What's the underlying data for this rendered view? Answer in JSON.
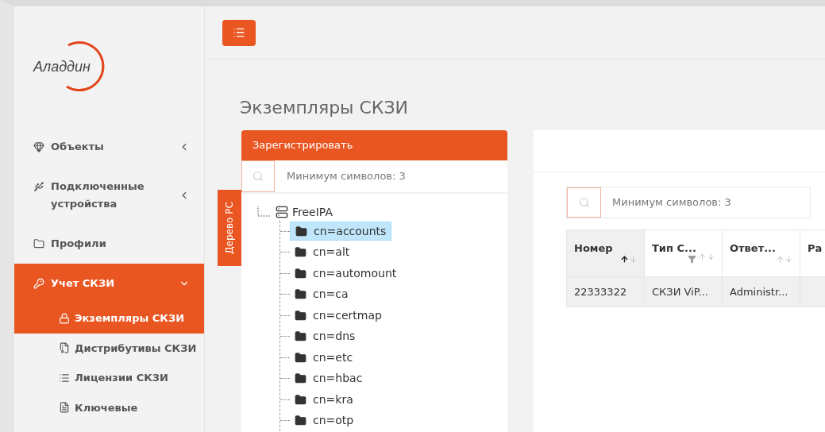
{
  "logo": {
    "text": "Аладдин"
  },
  "sidebar": {
    "items": [
      {
        "label": "Объекты",
        "kind": "group",
        "expanded": false,
        "selected": false
      },
      {
        "label": "Подключенные устройства",
        "kind": "group",
        "expanded": false,
        "selected": false
      },
      {
        "label": "Профили",
        "kind": "link",
        "selected": false
      },
      {
        "label": "Учет СКЗИ",
        "kind": "group",
        "expanded": true,
        "selected": true,
        "children": [
          {
            "label": "Экземпляры СКЗИ",
            "selected": true
          },
          {
            "label": "Дистрибутивы СКЗИ",
            "selected": false
          },
          {
            "label": "Лицензии СКЗИ",
            "selected": false
          },
          {
            "label": "Ключевые",
            "selected": false
          }
        ]
      }
    ]
  },
  "page": {
    "title": "Экземпляры СКЗИ"
  },
  "register_button": "Зарегистрировать",
  "tree_tab": "Дерево РС",
  "tree_search": {
    "placeholder": "Минимум символов: 3"
  },
  "tree": {
    "label": "FreeIPA",
    "children": [
      {
        "label": "cn=accounts",
        "selected": true
      },
      {
        "label": "cn=alt",
        "selected": false
      },
      {
        "label": "cn=automount",
        "selected": false
      },
      {
        "label": "cn=ca",
        "selected": false
      },
      {
        "label": "cn=certmap",
        "selected": false
      },
      {
        "label": "cn=dns",
        "selected": false
      },
      {
        "label": "cn=etc",
        "selected": false
      },
      {
        "label": "cn=hbac",
        "selected": false
      },
      {
        "label": "cn=kra",
        "selected": false
      },
      {
        "label": "cn=otp",
        "selected": false
      }
    ]
  },
  "table_search": {
    "placeholder": "Минимум символов: 3"
  },
  "table": {
    "columns": [
      {
        "label": "Номер",
        "sorted_ascending": true,
        "filter": false
      },
      {
        "label": "Тип С...",
        "sorted_ascending": false,
        "filter": true
      },
      {
        "label": "Ответ...",
        "sorted_ascending": false,
        "filter": false
      },
      {
        "label": "Ра"
      }
    ],
    "rows": [
      [
        "22333322",
        "СКЗИ ViP...",
        "Administr...",
        ""
      ]
    ]
  }
}
